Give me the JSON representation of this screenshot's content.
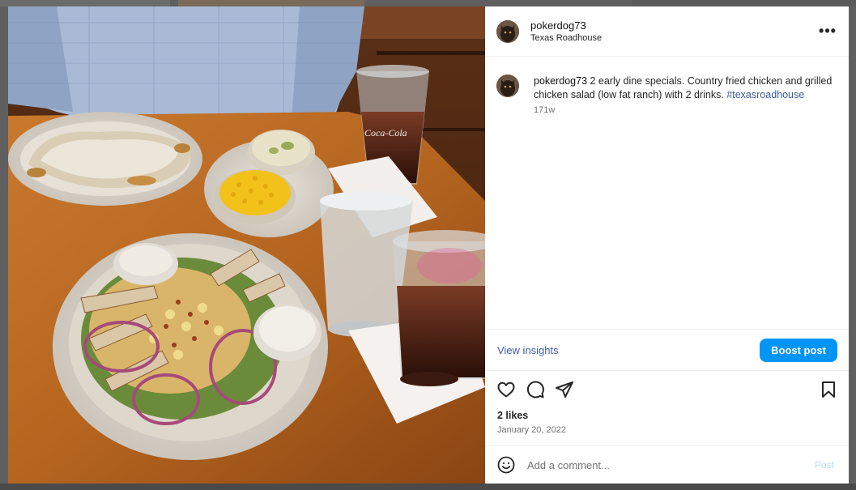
{
  "post": {
    "author": {
      "username": "pokerdog73",
      "location": "Texas Roadhouse",
      "avatar_icon": "profile-avatar-dog"
    },
    "menu_icon": "more-options-icon",
    "more_label": "•••",
    "caption": {
      "username": "pokerdog73",
      "text": " 2 early dine specials. Country fried chicken and grilled chicken salad (low fat ranch) with 2 drinks. ",
      "hashtag": "#texasroadhouse",
      "age": "171w"
    },
    "insights": {
      "view_label": "View insights",
      "boost_label": "Boost post"
    },
    "actions": {
      "like_icon": "heart-icon",
      "comment_icon": "comment-icon",
      "share_icon": "share-icon",
      "save_icon": "bookmark-icon"
    },
    "likes": "2 likes",
    "date": "January 20, 2022",
    "comment_box": {
      "emoji_icon": "emoji-icon",
      "placeholder": "Add a comment...",
      "post_label": "Post"
    }
  },
  "colors": {
    "accent": "#0095f6",
    "link": "#3b5ea8",
    "hashtag": "#3d5c99",
    "muted": "#737373",
    "post_disabled": "#b3dbff"
  }
}
